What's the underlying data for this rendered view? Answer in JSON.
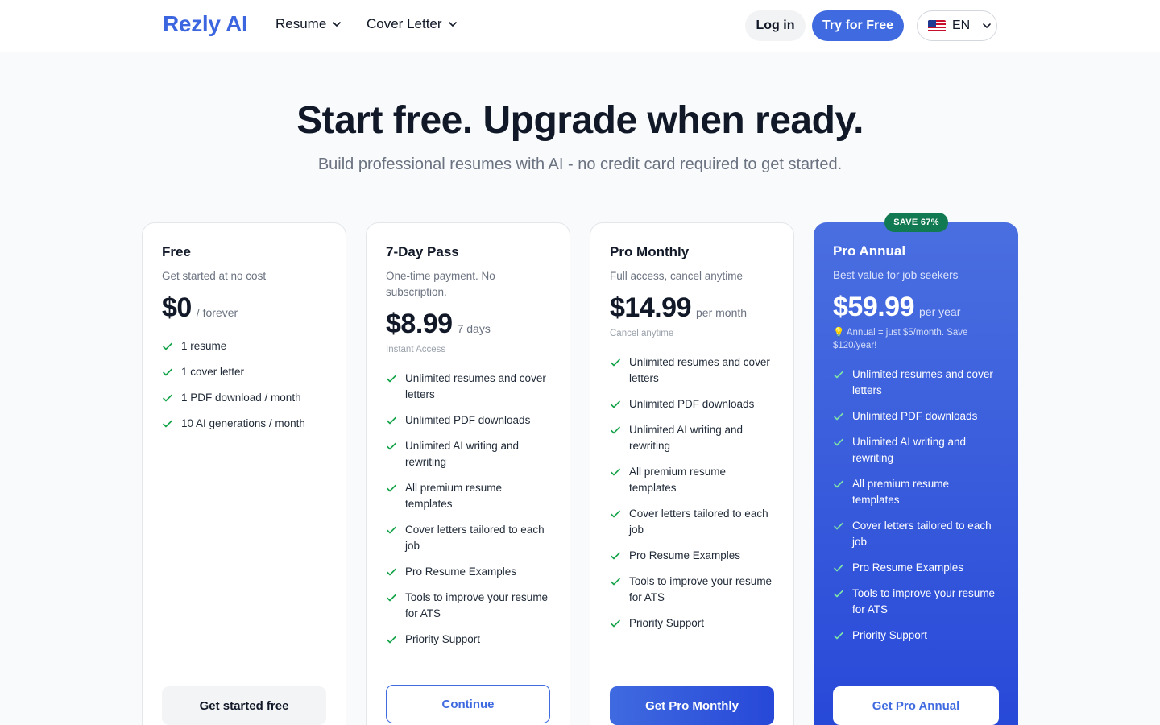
{
  "header": {
    "logo": "Rezly AI",
    "nav": [
      {
        "label": "Resume"
      },
      {
        "label": "Cover Letter"
      }
    ],
    "login_label": "Log in",
    "try_label": "Try for Free",
    "language": "EN"
  },
  "hero": {
    "title": "Start free. Upgrade when ready.",
    "subtitle": "Build professional resumes with AI - no credit card required to get started."
  },
  "plans": [
    {
      "name": "Free",
      "description": "Get started at no cost",
      "price": "$0",
      "period": "/ forever",
      "note": "",
      "features": [
        "1 resume",
        "1 cover letter",
        "1 PDF download / month",
        "10 AI generations / month"
      ],
      "cta": "Get started free"
    },
    {
      "name": "7-Day Pass",
      "description": "One-time payment. No subscription.",
      "price": "$8.99",
      "period": "7 days",
      "note": "Instant Access",
      "features": [
        "Unlimited resumes and cover letters",
        "Unlimited PDF downloads",
        "Unlimited AI writing and rewriting",
        "All premium resume templates",
        "Cover letters tailored to each job",
        "Pro Resume Examples",
        "Tools to improve your resume for ATS",
        "Priority Support"
      ],
      "cta": "Continue"
    },
    {
      "name": "Pro Monthly",
      "description": "Full access, cancel anytime",
      "price": "$14.99",
      "period": "per month",
      "note": "Cancel anytime",
      "features": [
        "Unlimited resumes and cover letters",
        "Unlimited PDF downloads",
        "Unlimited AI writing and rewriting",
        "All premium resume templates",
        "Cover letters tailored to each job",
        "Pro Resume Examples",
        "Tools to improve your resume for ATS",
        "Priority Support"
      ],
      "cta": "Get Pro Monthly"
    },
    {
      "name": "Pro Annual",
      "description": "Best value for job seekers",
      "price": "$59.99",
      "period": "per year",
      "note": "💡 Annual = just $5/month. Save $120/year!",
      "badge": "SAVE 67%",
      "features": [
        "Unlimited resumes and cover letters",
        "Unlimited PDF downloads",
        "Unlimited AI writing and rewriting",
        "All premium resume templates",
        "Cover letters tailored to each job",
        "Pro Resume Examples",
        "Tools to improve your resume for ATS",
        "Priority Support"
      ],
      "cta": "Get Pro Annual"
    }
  ],
  "colors": {
    "brand": "#3f6ae0",
    "check": "#16a34a",
    "check_on_blue": "#7ee2a8",
    "badge": "#127a52"
  }
}
